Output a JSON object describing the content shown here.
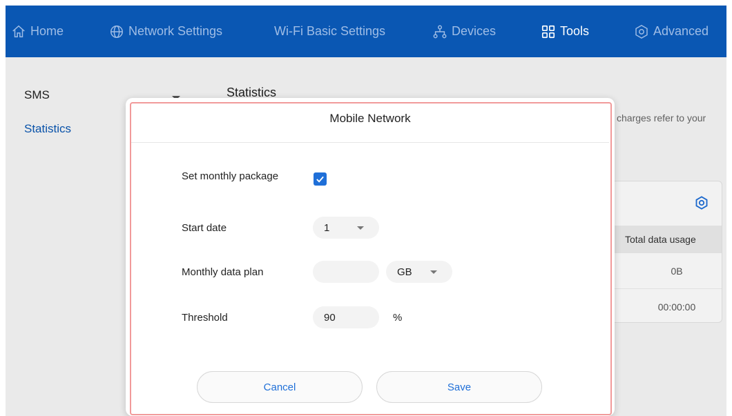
{
  "nav": {
    "items": [
      {
        "label": "Home",
        "icon": "home-icon"
      },
      {
        "label": "Network Settings",
        "icon": "globe-icon"
      },
      {
        "label": "Wi-Fi Basic Settings",
        "icon": ""
      },
      {
        "label": "Devices",
        "icon": "devices-icon"
      },
      {
        "label": "Tools",
        "icon": "tools-grid-icon",
        "active": true
      },
      {
        "label": "Advanced",
        "icon": "gear-icon"
      }
    ]
  },
  "sidebar": {
    "items": [
      {
        "label": "SMS"
      },
      {
        "label": "Statistics",
        "active": true
      }
    ]
  },
  "page": {
    "title": "Statistics",
    "notice": "charges refer to your"
  },
  "card": {
    "column_header": "Total data usage",
    "values": [
      "0B",
      "00:00:00"
    ]
  },
  "modal": {
    "title": "Mobile Network",
    "set_package_label": "Set monthly package",
    "set_package_checked": true,
    "start_date_label": "Start date",
    "start_date_value": "1",
    "data_plan_label": "Monthly data plan",
    "data_plan_value": "",
    "data_plan_unit": "GB",
    "threshold_label": "Threshold",
    "threshold_value": "90",
    "threshold_unit": "%",
    "cancel_label": "Cancel",
    "save_label": "Save"
  },
  "colors": {
    "brand": "#0a57b3",
    "accent": "#1f6fd8",
    "highlight_border": "#f19a9a"
  }
}
